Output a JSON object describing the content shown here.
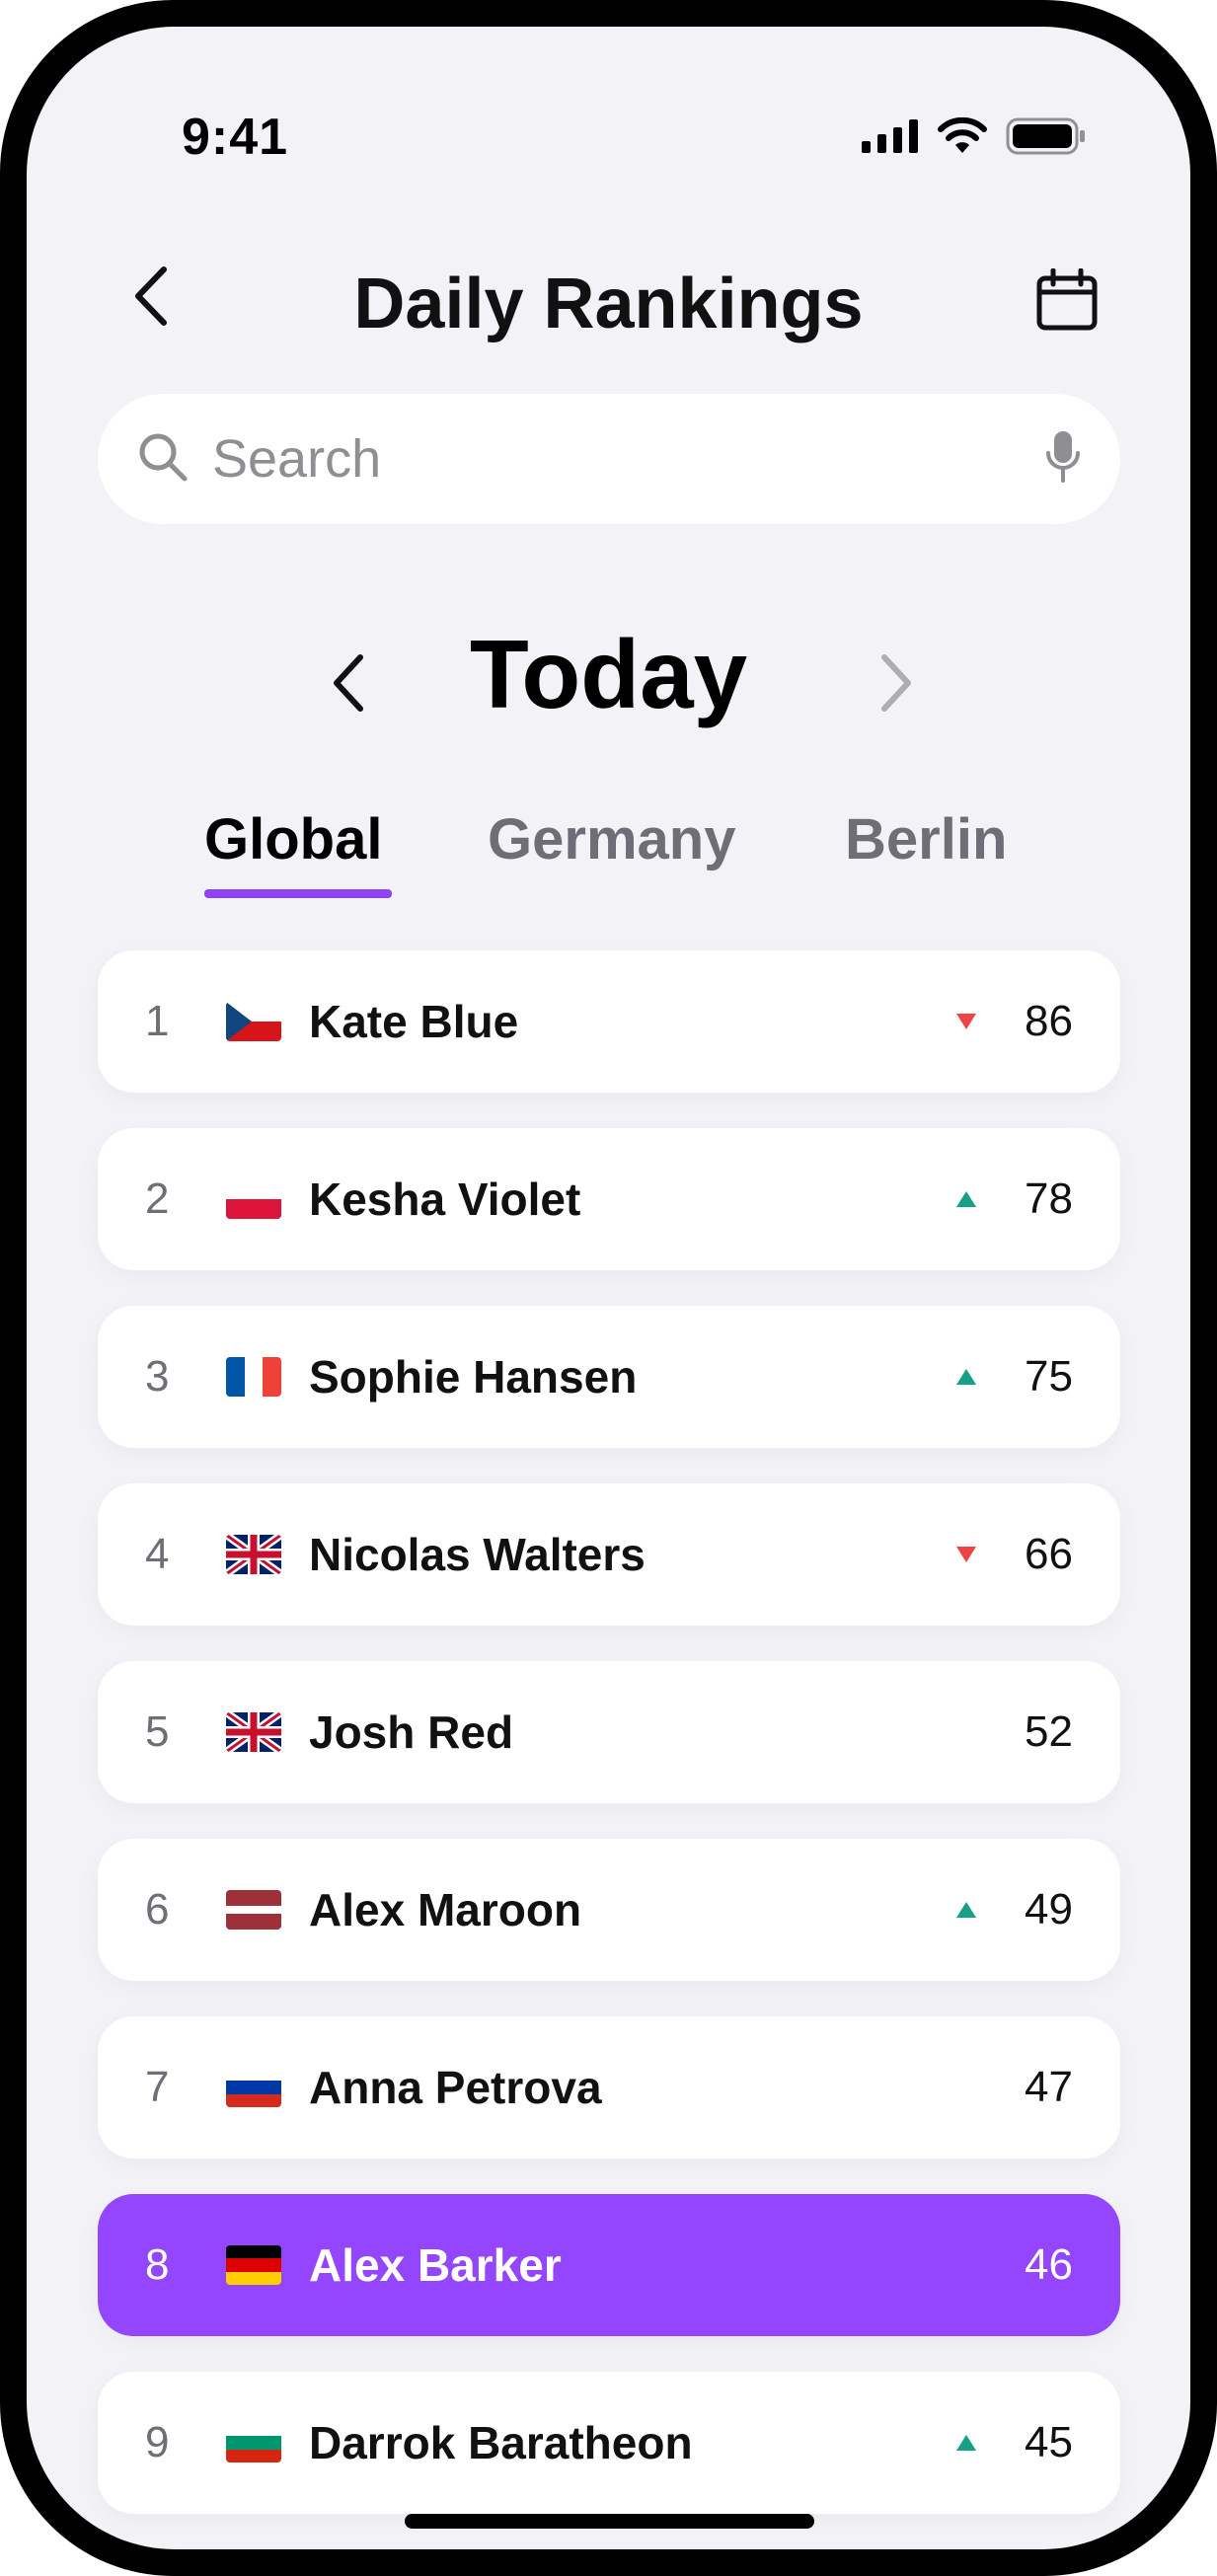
{
  "status_bar": {
    "time": "9:41"
  },
  "header": {
    "title": "Daily Rankings"
  },
  "search": {
    "placeholder": "Search",
    "value": ""
  },
  "day_selector": {
    "label": "Today"
  },
  "tabs": [
    {
      "label": "Global",
      "active": true
    },
    {
      "label": "Germany",
      "active": false
    },
    {
      "label": "Berlin",
      "active": false
    }
  ],
  "colors": {
    "accent": "#9346fd",
    "up": "#16a085",
    "down": "#ef4444",
    "background": "#f2f2f7"
  },
  "rankings": [
    {
      "rank": "1",
      "flag": "czech-flag",
      "name": "Kate Blue",
      "trend": "down",
      "score": "86"
    },
    {
      "rank": "2",
      "flag": "poland-flag",
      "name": "Kesha Violet",
      "trend": "up",
      "score": "78"
    },
    {
      "rank": "3",
      "flag": "france-flag",
      "name": "Sophie Hansen",
      "trend": "up",
      "score": "75"
    },
    {
      "rank": "4",
      "flag": "uk-flag",
      "name": "Nicolas Walters",
      "trend": "down",
      "score": "66"
    },
    {
      "rank": "5",
      "flag": "uk-flag",
      "name": "Josh Red",
      "trend": "none",
      "score": "52"
    },
    {
      "rank": "6",
      "flag": "latvia-flag",
      "name": "Alex Maroon",
      "trend": "up",
      "score": "49"
    },
    {
      "rank": "7",
      "flag": "russia-flag",
      "name": "Anna Petrova",
      "trend": "none",
      "score": "47"
    },
    {
      "rank": "8",
      "flag": "germany-flag",
      "name": "Alex Barker",
      "trend": "none",
      "score": "46",
      "highlight": true
    },
    {
      "rank": "9",
      "flag": "bulgaria-flag",
      "name": "Darrok Baratheon",
      "trend": "up",
      "score": "45"
    }
  ]
}
